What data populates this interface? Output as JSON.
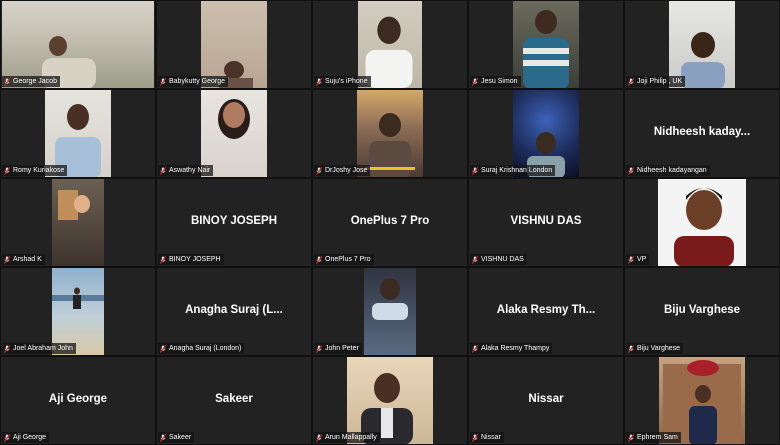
{
  "participants": [
    {
      "name": "George Jacob",
      "display": "",
      "video": "v1",
      "shape": "shape-a"
    },
    {
      "name": "Babykutty George",
      "display": "",
      "video": "v2",
      "shape": "shape-b"
    },
    {
      "name": "Suju's iPhone",
      "display": "",
      "video": "v3",
      "shape": "shape-c"
    },
    {
      "name": "Jesu Simon",
      "display": "",
      "video": "v4",
      "shape": "shape-d"
    },
    {
      "name": "Joji Philip , UK",
      "display": "",
      "video": "v5",
      "shape": "shape-e"
    },
    {
      "name": "Romy Kuriakose",
      "display": "",
      "video": "v6",
      "shape": "shape-f"
    },
    {
      "name": "Aswathy Nair",
      "display": "",
      "video": "v7",
      "shape": "shape-g"
    },
    {
      "name": "DrJoshy Jose",
      "display": "",
      "video": "v8",
      "shape": "shape-h"
    },
    {
      "name": "Suraj Krishnan London",
      "display": "",
      "video": "v9",
      "shape": "shape-i"
    },
    {
      "name": "Nidheesh kadayangan",
      "display": "Nidheesh  kaday...",
      "video": "",
      "shape": ""
    },
    {
      "name": "Arshad K",
      "display": "",
      "video": "v10",
      "shape": "shape-j"
    },
    {
      "name": "BINOY JOSEPH",
      "display": "BINOY JOSEPH",
      "video": "",
      "shape": ""
    },
    {
      "name": "OnePlus 7 Pro",
      "display": "OnePlus 7 Pro",
      "video": "",
      "shape": ""
    },
    {
      "name": "VISHNU DAS",
      "display": "VISHNU DAS",
      "video": "",
      "shape": ""
    },
    {
      "name": "VP",
      "display": "",
      "video": "v11",
      "shape": "shape-k"
    },
    {
      "name": "Joel Abraham John",
      "display": "",
      "video": "v12",
      "shape": "shape-l"
    },
    {
      "name": "Anagha Suraj (London)",
      "display": "Anagha Suraj  (L...",
      "video": "",
      "shape": ""
    },
    {
      "name": "John Peter",
      "display": "",
      "video": "v13",
      "shape": "shape-m"
    },
    {
      "name": "Alaka Resmy Thampy",
      "display": "Alaka Resmy  Th...",
      "video": "",
      "shape": ""
    },
    {
      "name": "Biju Varghese",
      "display": "Biju Varghese",
      "video": "",
      "shape": ""
    },
    {
      "name": "Aji George",
      "display": "Aji George",
      "video": "",
      "shape": ""
    },
    {
      "name": "Sakeer",
      "display": "Sakeer",
      "video": "",
      "shape": ""
    },
    {
      "name": "Arun Mallappally",
      "display": "",
      "video": "v14",
      "shape": "shape-n"
    },
    {
      "name": "Nissar",
      "display": "Nissar",
      "video": "",
      "shape": ""
    },
    {
      "name": "Ephrem Sam",
      "display": "",
      "video": "v15",
      "shape": "shape-o"
    }
  ],
  "colors": {
    "muted_mic": "#e0302f",
    "tile_bg": "#222222",
    "label_bg": "#141414"
  }
}
